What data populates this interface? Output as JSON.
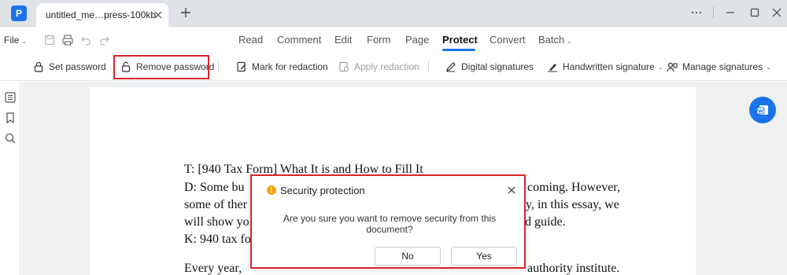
{
  "titlebar": {
    "tab_title": "untitled_me…press-100kb",
    "colors": {
      "brand": "#1a73e8"
    }
  },
  "menubar": {
    "file_label": "File",
    "tabs": [
      {
        "label": "Read"
      },
      {
        "label": "Comment"
      },
      {
        "label": "Edit"
      },
      {
        "label": "Form"
      },
      {
        "label": "Page"
      },
      {
        "label": "Protect",
        "active": true
      },
      {
        "label": "Convert"
      },
      {
        "label": "Batch"
      }
    ]
  },
  "toolbar": {
    "set_password": "Set password",
    "remove_password": "Remove password",
    "mark_for_redaction": "Mark for redaction",
    "apply_redaction": "Apply redaction",
    "digital_signatures": "Digital signatures",
    "handwritten_signature": "Handwritten signature",
    "manage_signatures": "Manage signatures",
    "highlight_color": "#d9262c"
  },
  "document": {
    "lines": [
      "T: [940 Tax Form] What It is and How to Fill It",
      "D: Some bu",
      "some of ther",
      "will show yo",
      "K: 940 tax fo",
      "Every year,"
    ],
    "right_fragments": [
      "coming. However,",
      "y, in this essay, we",
      "d guide.",
      "authority institute."
    ]
  },
  "dialog": {
    "title": "Security protection",
    "message": "Are you sure you want to remove security from this document?",
    "no_label": "No",
    "yes_label": "Yes",
    "icons": {
      "warning": "warning-icon",
      "close": "close-icon"
    }
  }
}
